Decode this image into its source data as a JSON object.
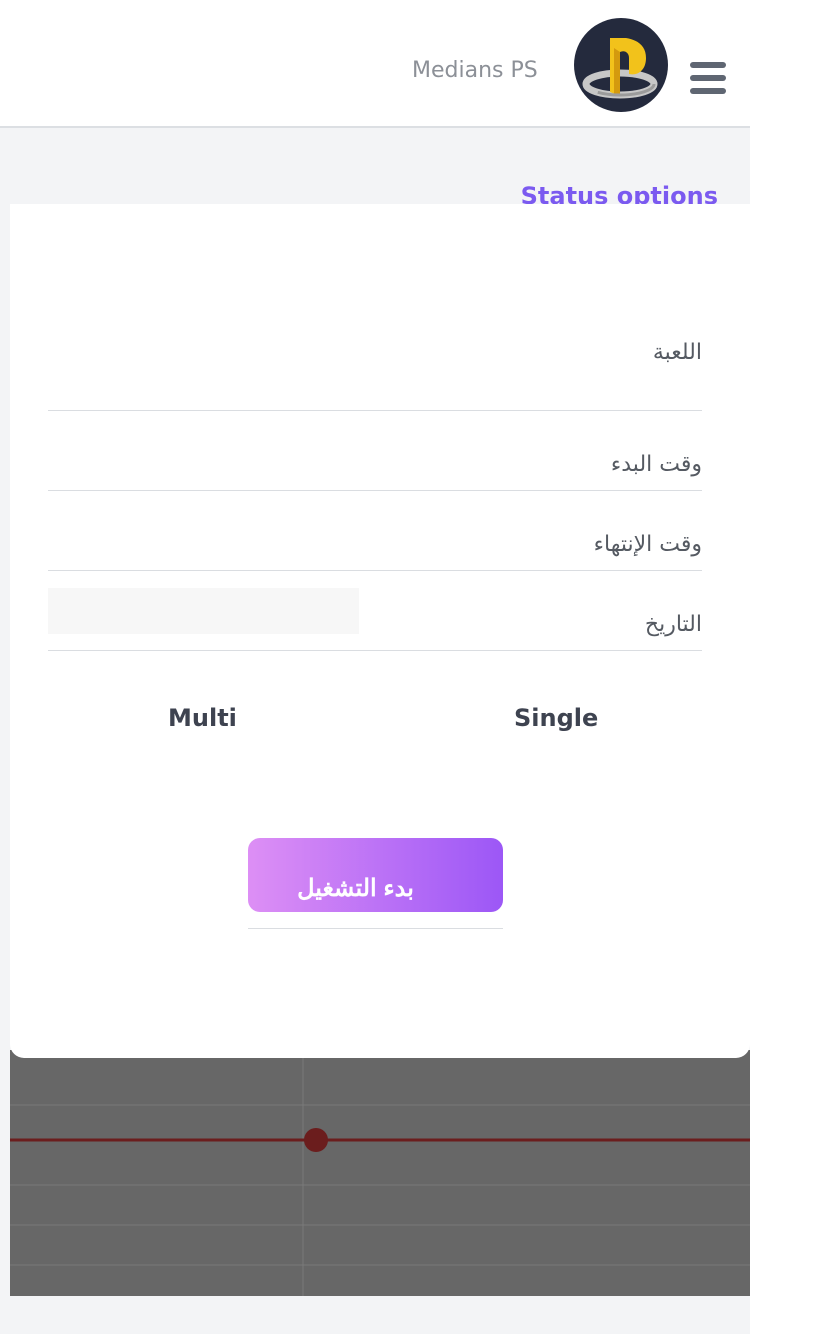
{
  "header": {
    "brand": "Medians PS",
    "avatar_icon": "playstation-logo-icon",
    "menu_icon": "hamburger-menu-icon"
  },
  "section": {
    "title": "Status options"
  },
  "form": {
    "game_label": "اللعبة",
    "start_time_label": "وقت البدء",
    "end_time_label": "وقت الإنتهاء",
    "date_label": "التاريخ",
    "date_value": ""
  },
  "modes": {
    "single": "Single",
    "multi": "Multi"
  },
  "actions": {
    "start_label": "بدء التشغيل"
  },
  "colors": {
    "accent": "#7b5af0",
    "button_from": "#dd8ff5",
    "button_to": "#9c57f6",
    "chart_line": "#6b1d1d"
  }
}
